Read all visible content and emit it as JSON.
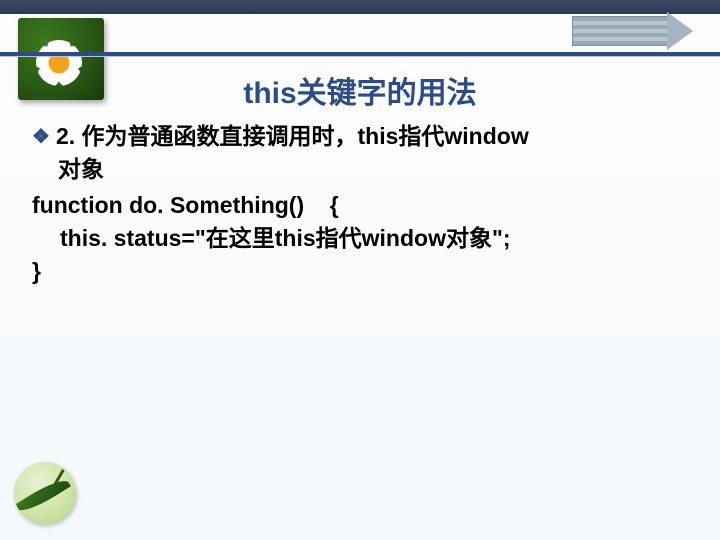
{
  "title": "this关键字的用法",
  "bullet": {
    "num": "2.",
    "text_line1": "作为普通函数直接调用时，this指代window",
    "text_line2": "对象"
  },
  "code": {
    "l1a": "function do. Something()",
    "l1b": "{",
    "l2": "this. status=\"在这里this指代window对象\"; ",
    "l3": "}"
  }
}
